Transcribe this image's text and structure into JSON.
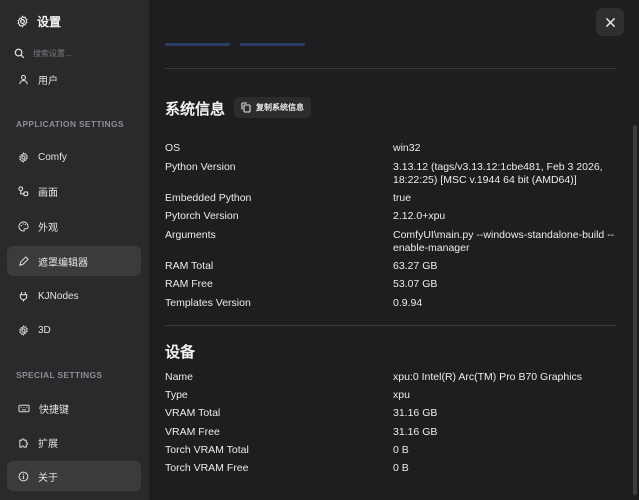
{
  "sidebar": {
    "title": "设置",
    "search_placeholder": "搜索设置...",
    "user_item": "用户",
    "section_app": "APPLICATION SETTINGS",
    "app_items": [
      {
        "label": "Comfy",
        "icon": "gear-icon"
      },
      {
        "label": "画面",
        "icon": "nodes-icon"
      },
      {
        "label": "外观",
        "icon": "palette-icon"
      },
      {
        "label": "遮罩编辑器",
        "icon": "mask-editor-icon"
      },
      {
        "label": "KJNodes",
        "icon": "plug-icon"
      },
      {
        "label": "3D",
        "icon": "cube-icon"
      }
    ],
    "section_special": "SPECIAL SETTINGS",
    "special_items": [
      {
        "label": "快捷键",
        "icon": "keyboard-icon"
      },
      {
        "label": "扩展",
        "icon": "puzzle-icon"
      },
      {
        "label": "关于",
        "icon": "info-icon"
      }
    ]
  },
  "system_info": {
    "title": "系统信息",
    "copy_label": "复制系统信息",
    "rows": [
      {
        "key": "OS",
        "value": "win32"
      },
      {
        "key": "Python Version",
        "value": "3.13.12 (tags/v3.13.12:1cbe481, Feb 3 2026, 18:22:25) [MSC v.1944 64 bit (AMD64)]"
      },
      {
        "key": "Embedded Python",
        "value": "true"
      },
      {
        "key": "Pytorch Version",
        "value": "2.12.0+xpu"
      },
      {
        "key": "Arguments",
        "value": "ComfyUI\\main.py --windows-standalone-build --enable-manager"
      },
      {
        "key": "RAM Total",
        "value": "63.27 GB"
      },
      {
        "key": "RAM Free",
        "value": "53.07 GB"
      },
      {
        "key": "Templates Version",
        "value": "0.9.94"
      }
    ]
  },
  "device": {
    "title": "设备",
    "rows": [
      {
        "key": "Name",
        "value": "xpu:0 Intel(R) Arc(TM) Pro B70 Graphics"
      },
      {
        "key": "Type",
        "value": "xpu"
      },
      {
        "key": "VRAM Total",
        "value": "31.16 GB"
      },
      {
        "key": "VRAM Free",
        "value": "31.16 GB"
      },
      {
        "key": "Torch VRAM Total",
        "value": "0 B"
      },
      {
        "key": "Torch VRAM Free",
        "value": "0 B"
      }
    ]
  }
}
